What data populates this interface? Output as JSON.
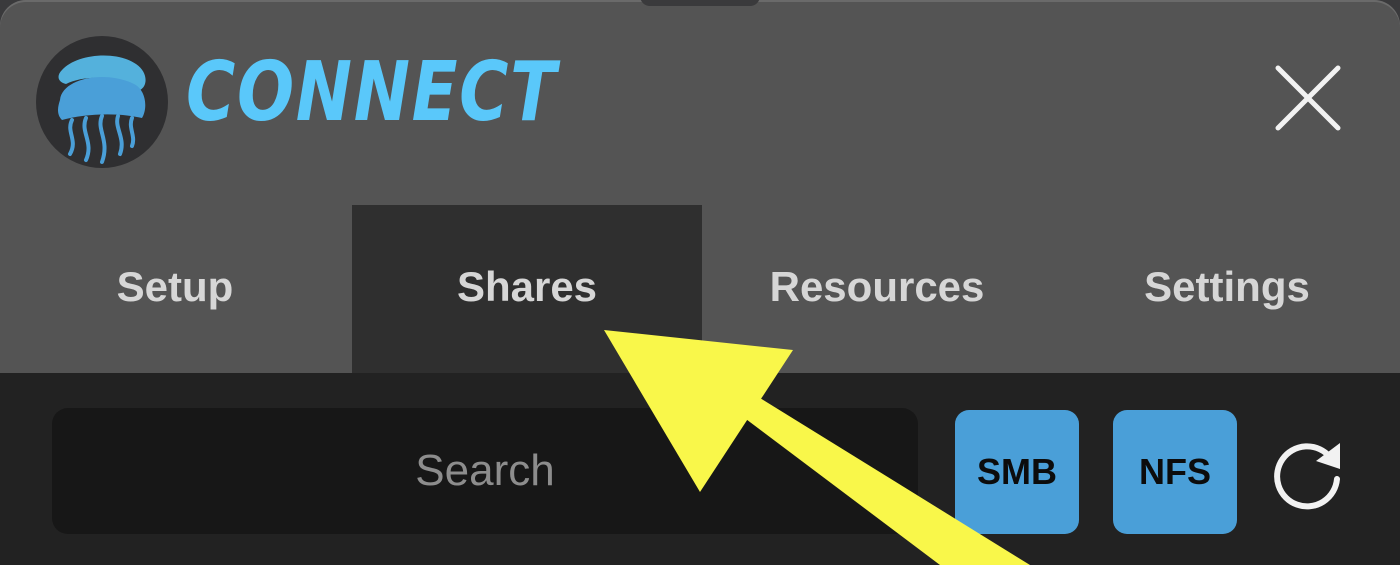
{
  "app": {
    "title": "CONNECT",
    "logo_icon": "jellyfish-logo-icon",
    "close_icon": "close-icon"
  },
  "tabs": [
    {
      "label": "Setup",
      "active": false
    },
    {
      "label": "Shares",
      "active": true
    },
    {
      "label": "Resources",
      "active": false
    },
    {
      "label": "Settings",
      "active": false
    }
  ],
  "toolbar": {
    "search_placeholder": "Search",
    "smb_label": "SMB",
    "nfs_label": "NFS",
    "refresh_icon": "refresh-icon"
  },
  "colors": {
    "accent": "#5ac8fa",
    "button_blue": "#4a9fd8",
    "annotation_arrow": "#f9f74a"
  }
}
